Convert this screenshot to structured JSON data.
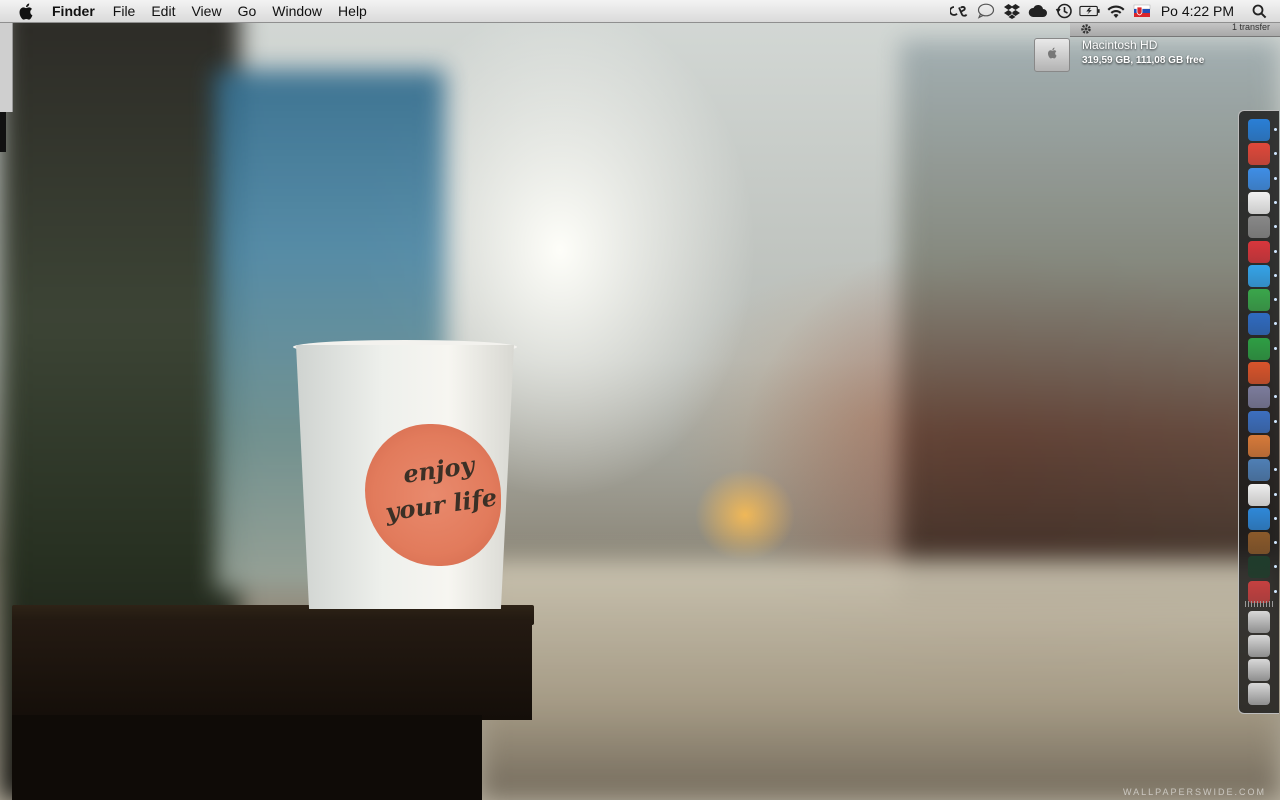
{
  "menubar": {
    "app_name": "Finder",
    "menus": [
      "File",
      "Edit",
      "View",
      "Go",
      "Window",
      "Help"
    ],
    "status_icons": [
      "lastfm-icon",
      "chat-bubble-icon",
      "dropbox-icon",
      "cloud-icon",
      "time-machine-icon",
      "battery-icon",
      "wifi-icon",
      "flag-icon"
    ],
    "clock": "Po 4:22 PM"
  },
  "transfer_strip": {
    "text": "1 transfer"
  },
  "desktop": {
    "drive": {
      "name": "Macintosh HD",
      "info": "319,59 GB, 111,08 GB free"
    },
    "wallpaper": {
      "cup_text": [
        "enjoy",
        "your life"
      ],
      "watermark": "WALLPAPERSWIDE.COM"
    }
  },
  "dock": {
    "items": [
      {
        "name": "finder-icon",
        "color": "#2a7fd6",
        "running": true
      },
      {
        "name": "chrome-icon",
        "color": "#e0483a",
        "running": true
      },
      {
        "name": "send-arrow-icon",
        "color": "#3f8ee6",
        "running": true
      },
      {
        "name": "calendar-icon",
        "color": "#f1f1f1",
        "running": true
      },
      {
        "name": "headphones-icon",
        "color": "#888888",
        "running": true
      },
      {
        "name": "lastfm-app-icon",
        "color": "#d8363c",
        "running": true
      },
      {
        "name": "twitter-icon",
        "color": "#35a3e8",
        "running": true
      },
      {
        "name": "adium-icon",
        "color": "#3aa64b",
        "running": true
      },
      {
        "name": "word-icon",
        "color": "#2f6bc1",
        "running": true
      },
      {
        "name": "excel-icon",
        "color": "#2e9e44",
        "running": true
      },
      {
        "name": "powerpoint-icon",
        "color": "#d9542b",
        "running": false
      },
      {
        "name": "pen-tool-icon",
        "color": "#7c7c9c",
        "running": true
      },
      {
        "name": "chart-app-icon",
        "color": "#3c6fbf",
        "running": true
      },
      {
        "name": "scanner-icon",
        "color": "#d77a3a",
        "running": false
      },
      {
        "name": "preview-icon",
        "color": "#4f7fb5",
        "running": true
      },
      {
        "name": "textedit-icon",
        "color": "#eeeeee",
        "running": true
      },
      {
        "name": "safari-icon",
        "color": "#2f88d8",
        "running": true
      },
      {
        "name": "books-icon",
        "color": "#8b5a2b",
        "running": true
      },
      {
        "name": "activity-monitor-icon",
        "color": "#1f3d2c",
        "running": true
      },
      {
        "name": "dictionary-icon",
        "color": "#c54040",
        "running": true
      }
    ],
    "folders": [
      {
        "name": "applications-folder-icon"
      },
      {
        "name": "documents-folder-icon"
      },
      {
        "name": "downloads-folder-icon"
      },
      {
        "name": "trash-icon"
      }
    ]
  }
}
